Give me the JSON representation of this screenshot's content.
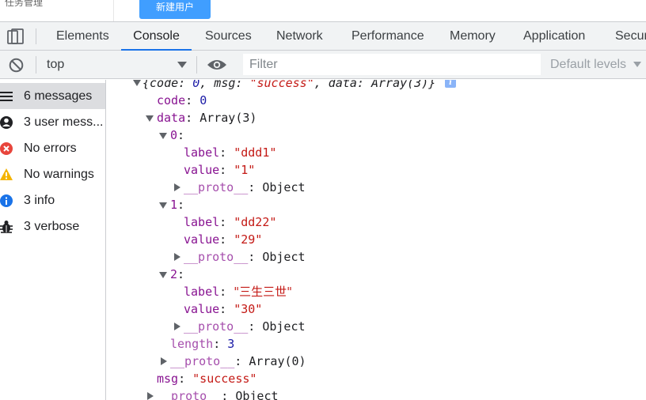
{
  "page": {
    "partial_text": "任务管理",
    "new_user_button": "新建用户"
  },
  "tabs": [
    "Elements",
    "Console",
    "Sources",
    "Network",
    "Performance",
    "Memory",
    "Application",
    "Secur"
  ],
  "toolbar": {
    "context": "top",
    "filter_placeholder": "Filter",
    "levels": "Default levels"
  },
  "sidebar": {
    "items": [
      {
        "label": "6 messages",
        "icon": "list-icon"
      },
      {
        "label": "3 user mess...",
        "icon": "user-icon"
      },
      {
        "label": "No errors",
        "icon": "error-icon"
      },
      {
        "label": "No warnings",
        "icon": "warning-icon"
      },
      {
        "label": "3 info",
        "icon": "info-icon"
      },
      {
        "label": "3 verbose",
        "icon": "bug-icon"
      }
    ]
  },
  "console": {
    "summary": {
      "p1": "{code: ",
      "code": "0",
      "p2": ", msg: ",
      "msg": "\"success\"",
      "p3": ", data: Array(3)}"
    },
    "code": {
      "key": "code",
      "value": "0"
    },
    "data": {
      "key": "data",
      "value": "Array(3)"
    },
    "items": [
      {
        "index": "0",
        "label": "\"ddd1\"",
        "value": "\"1\""
      },
      {
        "index": "1",
        "label": "\"dd22\"",
        "value": "\"29\""
      },
      {
        "index": "2",
        "label": "\"三生三世\"",
        "value": "\"30\""
      }
    ],
    "labels": {
      "label": "label",
      "value": "value",
      "proto": "__proto__",
      "object": "Object",
      "sep": ": "
    },
    "length": {
      "key": "length",
      "value": "3"
    },
    "data_proto_value": "Array(0)",
    "msg": {
      "key": "msg",
      "value": "\"success\""
    }
  },
  "colors": {
    "accent": "#1a73e8",
    "key": "#881391",
    "string": "#c41a16",
    "number": "#1a1aa6",
    "button": "#409eff"
  }
}
